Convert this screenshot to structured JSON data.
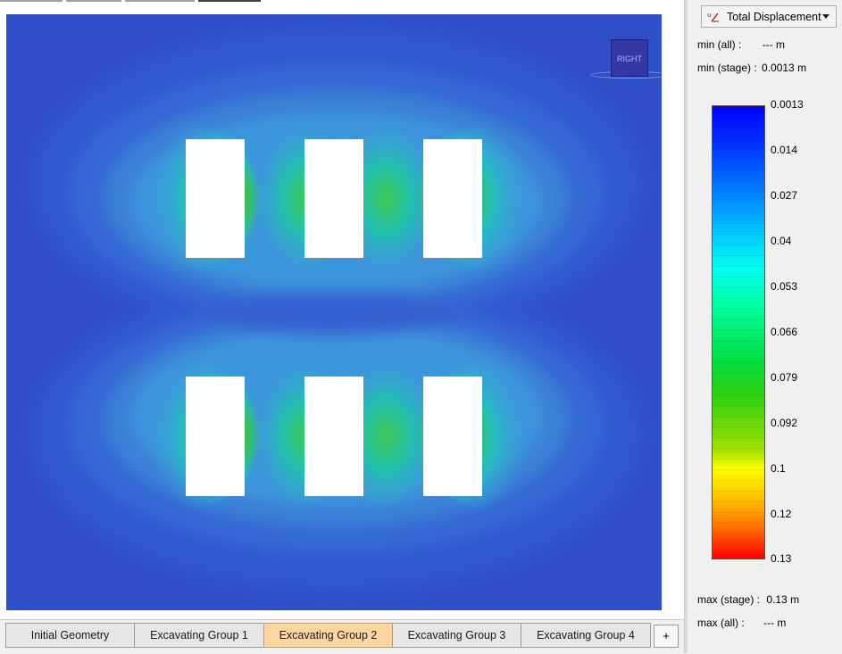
{
  "tabs": [
    {
      "label": "Initial Geometry",
      "active": false
    },
    {
      "label": "Excavating Group 1",
      "active": false
    },
    {
      "label": "Excavating Group 2",
      "active": true
    },
    {
      "label": "Excavating Group 3",
      "active": false
    },
    {
      "label": "Excavating Group 4",
      "active": false
    }
  ],
  "add_tab_label": "+",
  "view_cube_label": "RIGHT",
  "panel": {
    "result_type": "Total Displacement",
    "result_icon": "displacement-icon",
    "min_all_label": "min (all) :",
    "min_all_value": "--- m",
    "min_stage_label": "min (stage) :",
    "min_stage_value": "0.0013 m",
    "max_stage_label": "max (stage) :",
    "max_stage_value": "0.13 m",
    "max_all_label": "max (all) :",
    "max_all_value": "--- m"
  },
  "legend_ticks": [
    "0.0013",
    "0.014",
    "0.027",
    "0.04",
    "0.053",
    "0.066",
    "0.079",
    "0.092",
    "0.1",
    "0.12",
    "0.13"
  ],
  "colors": {
    "background_field": "#2f4fc9",
    "active_tab": "#fdd6a4",
    "excavation": "#ffffff"
  }
}
